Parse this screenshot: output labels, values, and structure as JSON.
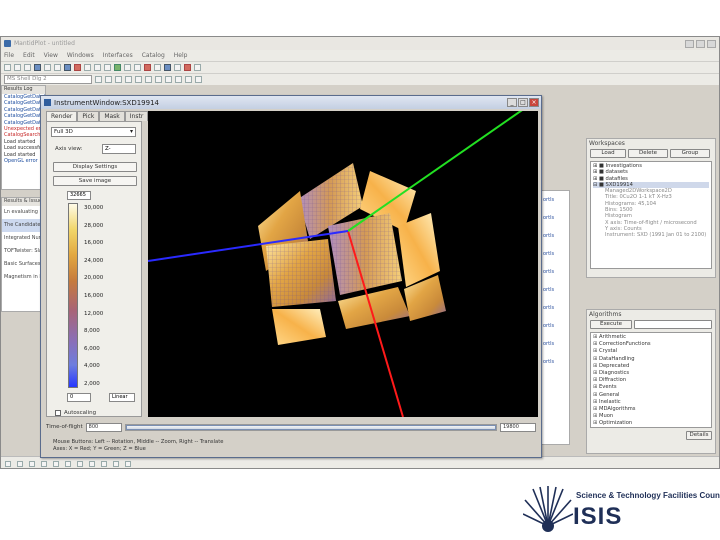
{
  "app": {
    "title": "MantidPlot - untitled",
    "menu": [
      "File",
      "Edit",
      "View",
      "Windows",
      "Interfaces",
      "Catalog",
      "Help"
    ],
    "workspace_combo": "MS Shell Dlg 2"
  },
  "results_log": {
    "title": "Results Log",
    "lines": [
      {
        "text": "CatalogGetDataS",
        "color": "blue"
      },
      {
        "text": "CatalogGetData",
        "color": "blue"
      },
      {
        "text": "CatalogGetData",
        "color": "blue"
      },
      {
        "text": "CatalogGetData",
        "color": "blue"
      },
      {
        "text": "CatalogGetData",
        "color": "blue"
      },
      {
        "text": "Unexpected error",
        "color": "red"
      },
      {
        "text": "CatalogSearch",
        "color": "red"
      },
      {
        "text": "Load started",
        "color": "black"
      },
      {
        "text": "Load successful",
        "color": "black"
      },
      {
        "text": "Load started",
        "color": "black"
      },
      {
        "text": "OpenGL error",
        "color": "blue"
      }
    ]
  },
  "background_list": {
    "title": "Results & Issues",
    "items": [
      "Ln evaluating Fold",
      "The Candidate Re",
      "Integrated Numbers",
      "TOFTwister: Slab",
      "Basic Surfaces",
      "Magnetism in Pell"
    ]
  },
  "instrument_window": {
    "title": "InstrumentWindow:SXD19914",
    "tabs": [
      "Render",
      "Pick",
      "Mask",
      "Instr"
    ],
    "render_mode": "Full 3D",
    "axis_view_label": "Axis view:",
    "axis_view_value": "Z-",
    "display_settings_label": "Display Settings",
    "save_image_label": "Save image",
    "colormap_max": "32665",
    "colormap_min": "0",
    "colormap_ticks": [
      "30,000",
      "28,000",
      "16,000",
      "24,000",
      "20,000",
      "16,000",
      "12,000",
      "8,000",
      "6,000",
      "4,000",
      "2,000"
    ],
    "scale_type": "Linear",
    "autoscaling_label": "Autoscaling",
    "tof_label": "Time-of-flight",
    "tof_min": "800",
    "tof_max": "19800",
    "help_line1": "Mouse Buttons: Left -- Rotation, Middle -- Zoom, Right -- Translate",
    "help_line2": "Axes: X = Red; Y = Green; Z = Blue"
  },
  "workspaces_panel": {
    "title": "Workspaces",
    "buttons": [
      "Load",
      "Delete",
      "Group"
    ],
    "tree": [
      {
        "text": "⊞ ■ Investigations",
        "type": "normal"
      },
      {
        "text": "⊞ ■ datasets",
        "type": "normal"
      },
      {
        "text": "⊞ ■ datafiles",
        "type": "normal"
      },
      {
        "text": "⊟ ■ SXD19914",
        "type": "sel"
      },
      {
        "text": "Managed2DWorkspace2D",
        "type": "dim"
      },
      {
        "text": "Title: 0Cu2O 1-1 kT X-Hz3",
        "type": "dim"
      },
      {
        "text": "Histograms: 45,104",
        "type": "dim"
      },
      {
        "text": "Bins: 1500",
        "type": "dim"
      },
      {
        "text": "Histogram",
        "type": "dim"
      },
      {
        "text": "X axis: Time-of-flight / microsecond",
        "type": "dim"
      },
      {
        "text": "Y axis: Counts",
        "type": "dim"
      },
      {
        "text": "Instrument: SXD (1991 Jan 01 to 2100)",
        "type": "dim"
      }
    ]
  },
  "algorithms_panel": {
    "title": "Algorithms",
    "execute_label": "Execute",
    "items": [
      "Arithmetic",
      "CorrectionFunctions",
      "Crystal",
      "DataHandling",
      "Deprecated",
      "Diagnostics",
      "Diffraction",
      "Events",
      "General",
      "Inelastic",
      "MDAlgorithms",
      "Muon",
      "Optimization"
    ],
    "details_label": "Details"
  },
  "mid_right_links": [
    "ortls",
    "ortls",
    "ortls",
    "ortls",
    "ortls",
    "ortls",
    "ortls",
    "ortls",
    "ortls",
    "ortls"
  ],
  "branding": {
    "council": "Science & Technology Facilities Council",
    "name": "ISIS",
    "primary_color": "#1f2f57"
  }
}
